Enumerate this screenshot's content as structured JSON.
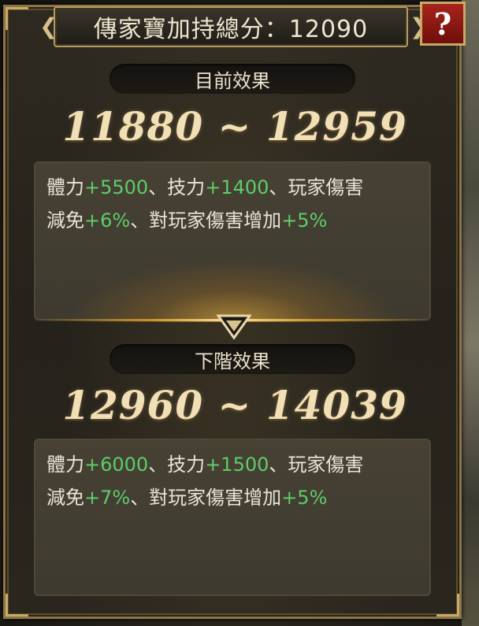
{
  "title": {
    "label": "傳家寶加持總分：12090"
  },
  "help_button": {
    "label": "?"
  },
  "current_effect": {
    "header": "目前效果",
    "range": "11880 ~ 12959",
    "line1": {
      "parts": [
        "體力",
        "+5500",
        "、技力",
        "+1400",
        "、玩家傷害"
      ]
    },
    "line2": {
      "parts": [
        "減免",
        "+6%",
        "、對玩家傷害增加",
        "+5%"
      ]
    }
  },
  "next_effect": {
    "header": "下階效果",
    "range": "12960 ~ 14039",
    "line1": {
      "parts": [
        "體力",
        "+6000",
        "、技力",
        "+1500",
        "、玩家傷害"
      ]
    },
    "line2": {
      "parts": [
        "減免",
        "+7%",
        "、對玩家傷害增加",
        "+5%"
      ]
    }
  },
  "colors": {
    "highlight_green": "#5fcc6a",
    "gold": "#c9a964",
    "help_red": "#a8231c"
  }
}
